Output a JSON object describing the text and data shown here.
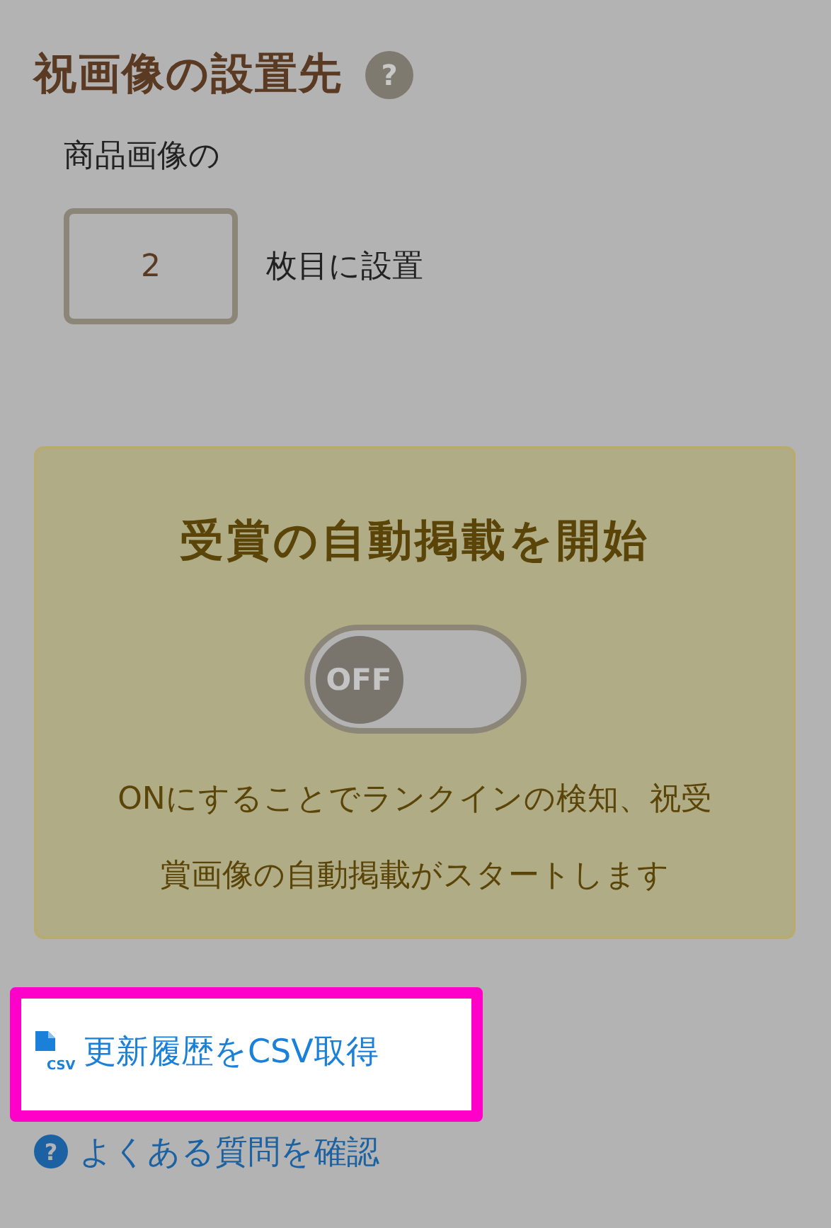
{
  "section": {
    "title": "祝画像の設置先",
    "help": "?"
  },
  "position": {
    "prefix": "商品画像の",
    "value": "2",
    "suffix": "枚目に設置"
  },
  "auto_post": {
    "title": "受賞の自動掲載を開始",
    "toggle": {
      "on": false,
      "label": "OFF"
    },
    "description": "ONにすることでランクインの検知、祝受賞画像の自動掲載がスタートします"
  },
  "links": [
    {
      "kind": "csv",
      "label": "更新履歴をCSV取得",
      "icon_text": "CSV",
      "highlighted": true
    },
    {
      "kind": "help",
      "label": "よくある質問を確認",
      "icon_text": "?",
      "highlighted": false
    }
  ]
}
